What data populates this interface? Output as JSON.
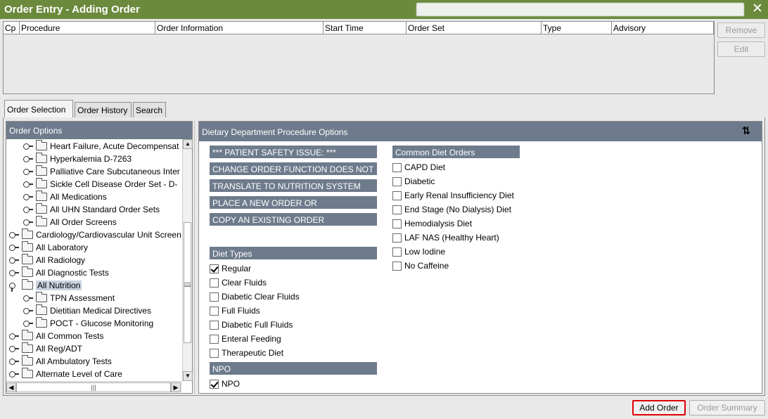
{
  "window": {
    "title": "Order Entry - Adding Order",
    "close_glyph": "✕"
  },
  "orders_table": {
    "columns": [
      "Cp",
      "Procedure",
      "Order Information",
      "Start Time",
      "Order Set",
      "Type",
      "Advisory"
    ],
    "rows": []
  },
  "side_buttons": {
    "remove": "Remove",
    "edit": "Edit"
  },
  "tabs": [
    {
      "label": "Order Selection",
      "active": true
    },
    {
      "label": "Order History",
      "active": false
    },
    {
      "label": "Search",
      "active": false
    }
  ],
  "order_options": {
    "header": "Order Options",
    "items": [
      {
        "label": "Heart Failure, Acute Decompensat",
        "level": 1,
        "expanded": false
      },
      {
        "label": "Hyperkalemia D-7263",
        "level": 1,
        "expanded": false
      },
      {
        "label": "Palliative Care Subcutaneous Inter",
        "level": 1,
        "expanded": false
      },
      {
        "label": "Sickle Cell Disease Order Set - D-",
        "level": 1,
        "expanded": false
      },
      {
        "label": "All Medications",
        "level": 1,
        "expanded": false
      },
      {
        "label": "All UHN Standard Order Sets",
        "level": 1,
        "expanded": false
      },
      {
        "label": "All Order Screens",
        "level": 1,
        "expanded": false
      },
      {
        "label": "Cardiology/Cardiovascular Unit Screen",
        "level": 0,
        "expanded": false
      },
      {
        "label": "All Laboratory",
        "level": 0,
        "expanded": false
      },
      {
        "label": "All Radiology",
        "level": 0,
        "expanded": false
      },
      {
        "label": "All Diagnostic Tests",
        "level": 0,
        "expanded": false
      },
      {
        "label": "All Nutrition",
        "level": 0,
        "expanded": true,
        "selected": true
      },
      {
        "label": "TPN Assessment",
        "level": 1,
        "expanded": false
      },
      {
        "label": "Dietitian Medical Directives",
        "level": 1,
        "expanded": false
      },
      {
        "label": "POCT - Glucose Monitoring",
        "level": 1,
        "expanded": false
      },
      {
        "label": "All Common Tests",
        "level": 0,
        "expanded": false
      },
      {
        "label": "All Reg/ADT",
        "level": 0,
        "expanded": false
      },
      {
        "label": "All Ambulatory Tests",
        "level": 0,
        "expanded": false
      },
      {
        "label": "Alternate Level of Care",
        "level": 0,
        "expanded": false
      }
    ]
  },
  "procedure_options": {
    "header": "Dietary Department Procedure Options",
    "notice_lines": [
      "*** PATIENT SAFETY ISSUE: ***",
      "CHANGE ORDER FUNCTION DOES NOT",
      "TRANSLATE TO NUTRITION SYSTEM",
      "PLACE A NEW ORDER OR",
      "COPY AN EXISTING ORDER"
    ],
    "diet_types": {
      "label": "Diet Types",
      "options": [
        {
          "label": "Regular",
          "checked": true
        },
        {
          "label": "Clear Fluids",
          "checked": false
        },
        {
          "label": "Diabetic Clear Fluids",
          "checked": false
        },
        {
          "label": "Full Fluids",
          "checked": false
        },
        {
          "label": "Diabetic Full Fluids",
          "checked": false
        },
        {
          "label": "Enteral Feeding",
          "checked": false
        },
        {
          "label": "Therapeutic Diet",
          "checked": false
        }
      ]
    },
    "npo": {
      "label": "NPO",
      "options": [
        {
          "label": "NPO",
          "checked": true
        }
      ]
    },
    "common_diet_orders": {
      "label": "Common Diet Orders",
      "options": [
        {
          "label": "CAPD Diet",
          "checked": false
        },
        {
          "label": "Diabetic",
          "checked": false
        },
        {
          "label": "Early Renal Insufficiency Diet",
          "checked": false
        },
        {
          "label": "End Stage (No Dialysis) Diet",
          "checked": false
        },
        {
          "label": "Hemodialysis Diet",
          "checked": false
        },
        {
          "label": "LAF NAS (Healthy Heart)",
          "checked": false
        },
        {
          "label": "Low Iodine",
          "checked": false
        },
        {
          "label": "No Caffeine",
          "checked": false
        }
      ]
    }
  },
  "bottom_buttons": {
    "add_order": "Add Order",
    "order_summary": "Order Summary"
  },
  "colors": {
    "titlebar": "#6b8a3c",
    "panel_header": "#6e7b8c",
    "highlight_border": "#e00000"
  }
}
